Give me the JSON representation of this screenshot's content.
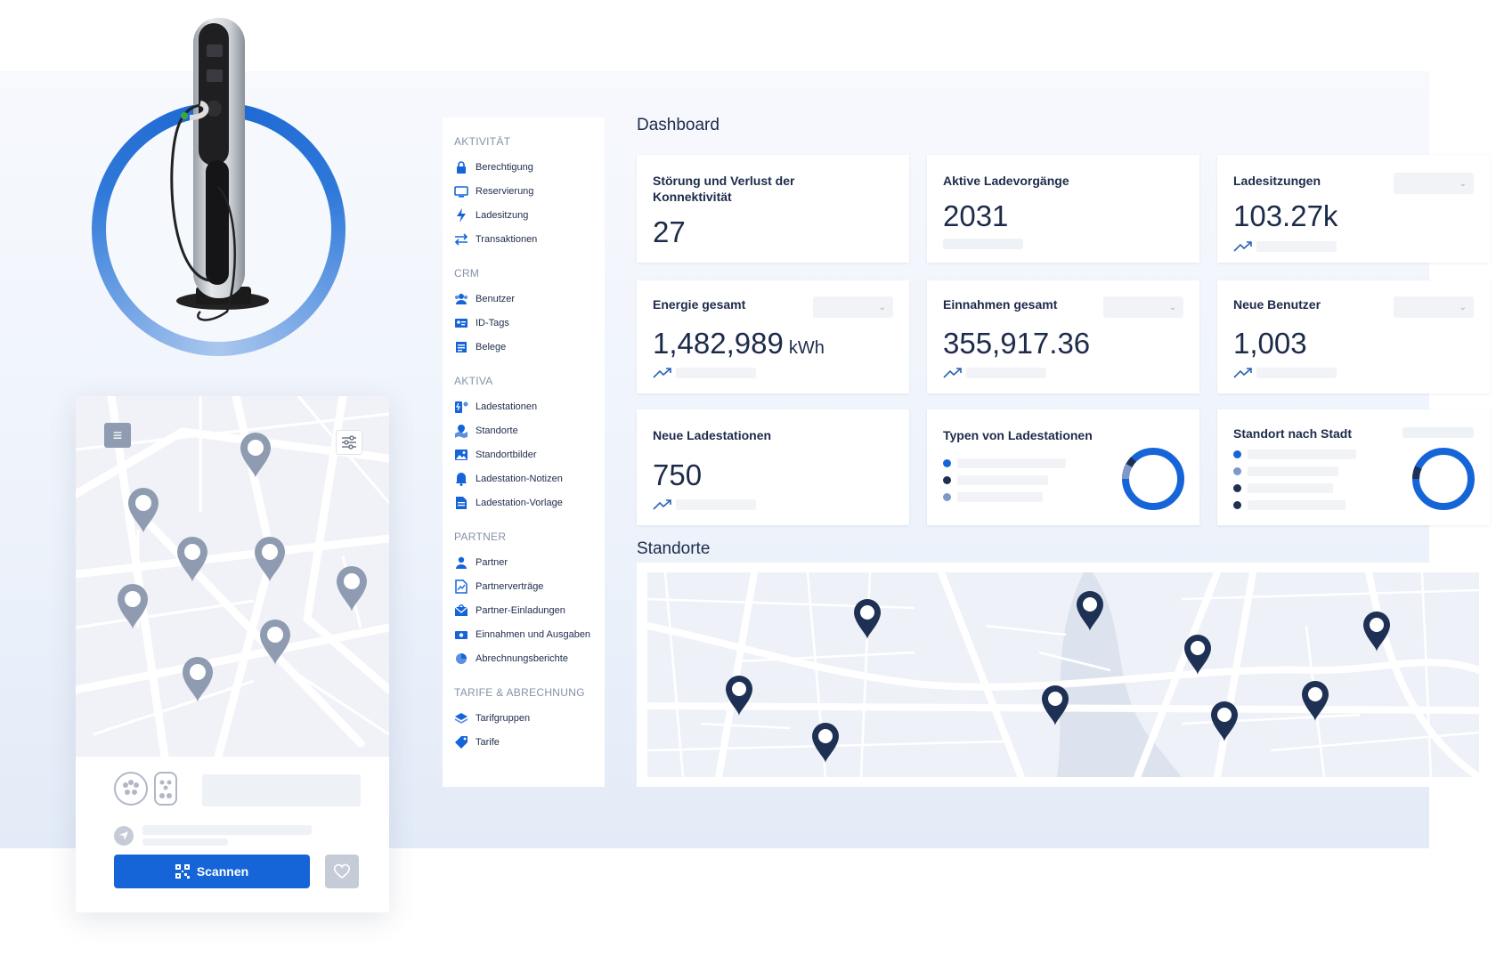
{
  "sidebar": {
    "sections": [
      {
        "title": "AKTIVITÄT",
        "items": [
          {
            "label": "Berechtigung",
            "icon": "lock-icon"
          },
          {
            "label": "Reservierung",
            "icon": "monitor-icon"
          },
          {
            "label": "Ladesitzung",
            "icon": "lightning-icon"
          },
          {
            "label": "Transaktionen",
            "icon": "swap-arrows-icon"
          }
        ]
      },
      {
        "title": "CRM",
        "items": [
          {
            "label": "Benutzer",
            "icon": "users-icon"
          },
          {
            "label": "ID-Tags",
            "icon": "id-card-icon"
          },
          {
            "label": "Belege",
            "icon": "receipt-icon"
          }
        ]
      },
      {
        "title": "AKTIVA",
        "items": [
          {
            "label": "Ladestationen",
            "icon": "charging-station-icon"
          },
          {
            "label": "Standorte",
            "icon": "map-icon"
          },
          {
            "label": "Standortbilder",
            "icon": "image-icon"
          },
          {
            "label": "Ladestation-Notizen",
            "icon": "bell-icon"
          },
          {
            "label": "Ladestation-Vorlage",
            "icon": "document-icon"
          }
        ]
      },
      {
        "title": "PARTNER",
        "items": [
          {
            "label": "Partner",
            "icon": "person-icon"
          },
          {
            "label": "Partnerverträge",
            "icon": "contract-icon"
          },
          {
            "label": "Partner-Einladungen",
            "icon": "envelope-icon"
          },
          {
            "label": "Einnahmen und Ausgaben",
            "icon": "money-icon"
          },
          {
            "label": "Abrechnungsberichte",
            "icon": "pie-chart-icon"
          }
        ]
      },
      {
        "title": "TARIFE & ABRECHNUNG",
        "items": [
          {
            "label": "Tarifgruppen",
            "icon": "layers-icon"
          },
          {
            "label": "Tarife",
            "icon": "tag-icon"
          }
        ]
      }
    ]
  },
  "dashboard": {
    "title": "Dashboard",
    "cards": {
      "stoerung": {
        "title": "Störung und Verlust der Konnektivität",
        "value": "27"
      },
      "aktive": {
        "title": "Aktive Ladevorgänge",
        "value": "2031"
      },
      "sitzungen": {
        "title": "Ladesitzungen",
        "value": "103.27k"
      },
      "energie": {
        "title": "Energie gesamt",
        "value": "1,482,989",
        "unit": "kWh"
      },
      "einnahmen": {
        "title": "Einnahmen gesamt",
        "value": "355,917.36"
      },
      "neue_benutzer": {
        "title": "Neue Benutzer",
        "value": "1,003"
      },
      "neue_stationen": {
        "title": "Neue Ladestationen",
        "value": "750"
      },
      "typen": {
        "title": "Typen von Ladestationen"
      },
      "stadt": {
        "title": "Standort nach Stadt"
      }
    },
    "standorte_title": "Standorte"
  },
  "mobile": {
    "scan_label": "Scannen"
  },
  "colors": {
    "accent": "#1565d8",
    "navy": "#1d2b4a",
    "pin_gray": "#8f9bb1",
    "pin_navy": "#1e3154"
  }
}
